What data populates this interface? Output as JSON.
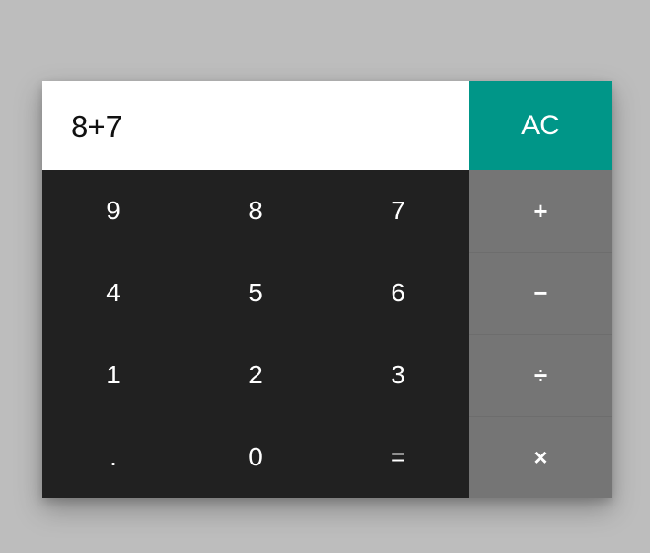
{
  "display": {
    "expression": "8+7"
  },
  "clear": {
    "label": "AC"
  },
  "keypad": [
    [
      "9",
      "8",
      "7"
    ],
    [
      "4",
      "5",
      "6"
    ],
    [
      "1",
      "2",
      "3"
    ],
    [
      ".",
      "0",
      "="
    ]
  ],
  "operators": [
    "+",
    "−",
    "÷",
    "×"
  ],
  "colors": {
    "background": "#bdbdbd",
    "display_bg": "#ffffff",
    "clear_bg": "#009688",
    "keypad_bg": "#212121",
    "operator_bg": "#757575"
  }
}
